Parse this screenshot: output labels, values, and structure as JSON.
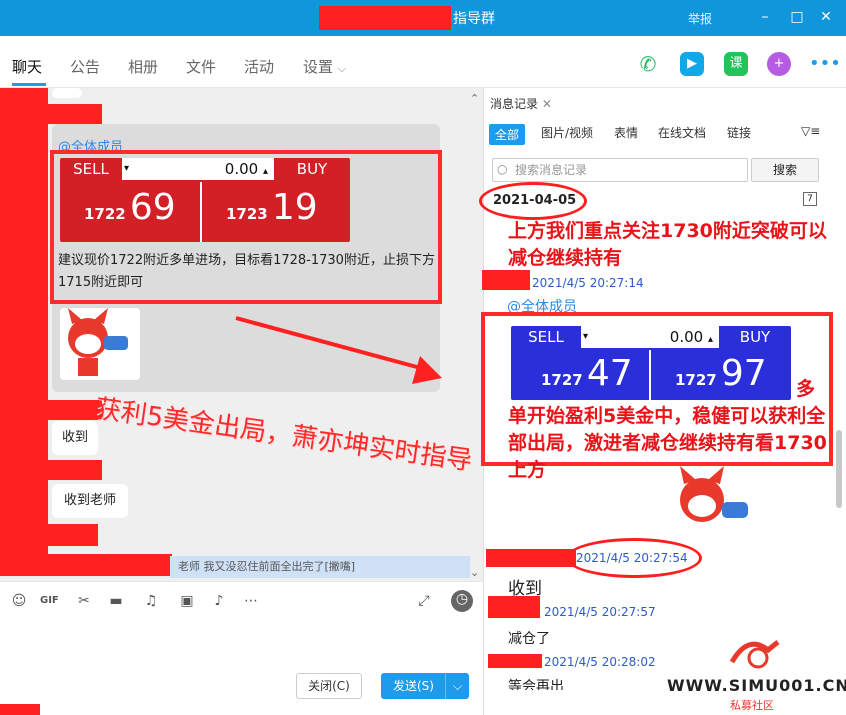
{
  "window": {
    "title": "指导群",
    "report_label": "举报",
    "minimize": "–",
    "maximize": "□",
    "close": "✕"
  },
  "tabs": [
    {
      "label": "聊天"
    },
    {
      "label": "公告"
    },
    {
      "label": "相册"
    },
    {
      "label": "文件"
    },
    {
      "label": "活动"
    },
    {
      "label": "设置"
    }
  ],
  "toolbar_icons": [
    "phone-icon",
    "video-icon",
    "course-icon",
    "add-app-icon",
    "more-icon"
  ],
  "chat": {
    "mention": "@全体成员",
    "ticket": {
      "sell": "SELL",
      "buy": "BUY",
      "lot": "0.00",
      "sell_small": "1722",
      "sell_big": "69",
      "buy_small": "1723",
      "buy_big": "19"
    },
    "message_text": "建议现价1722附近多单进场，目标看1728-1730附近，止损下方1715附近即可",
    "overlay_text": "获利5美金出局，萧亦坤实时指导",
    "reply1": "收到",
    "reply2": "收到老师",
    "notice": "老师 我又没忍住前面全出完了[撇嘴]"
  },
  "input": {
    "icons": [
      "emoji-icon",
      "gif-icon",
      "scissors-icon",
      "folder-icon",
      "music-icon",
      "image-icon",
      "bell-icon",
      "more-icon"
    ],
    "close_label": "关闭(C)",
    "send_label": "发送(S)"
  },
  "history": {
    "tab_label": "消息记录",
    "filters": [
      "全部",
      "图片/视频",
      "表情",
      "在线文档",
      "链接"
    ],
    "search_placeholder": "搜索消息记录",
    "search_button": "搜索",
    "date": "2021-04-05",
    "msg1": "上方我们重点关注1730附近突破可以减仓继续持有",
    "ts1": "2021/4/5 20:27:14",
    "mention": "@全体成员",
    "ticket": {
      "sell": "SELL",
      "buy": "BUY",
      "lot": "0.00",
      "sell_small": "1727",
      "sell_big": "47",
      "buy_small": "1727",
      "buy_big": "97"
    },
    "msg2": "多单开始盈利5美金中，稳健可以获利全部出局，激进者减仓继续持有看1730上方",
    "ts2": "2021/4/5 20:27:54",
    "reply1": "收到",
    "ts3": "2021/4/5 20:27:57",
    "reply2": "减仓了",
    "ts4": "2021/4/5 20:28:02",
    "reply3": "等会再出"
  },
  "watermark": {
    "line1": "WWW.SIMU001.CN",
    "line2": "私募社区"
  }
}
